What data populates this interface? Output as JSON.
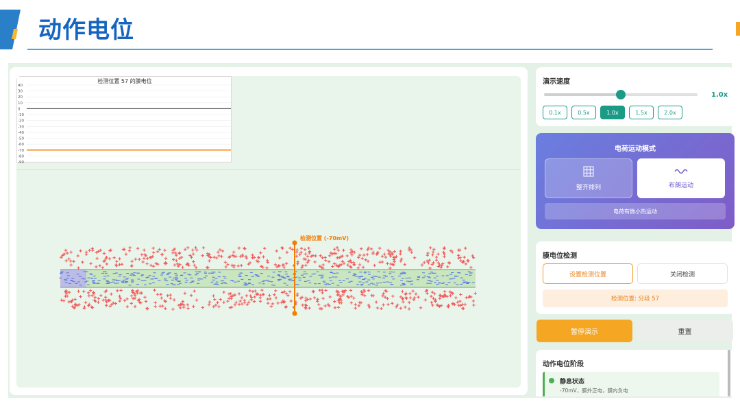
{
  "slide": {
    "title": "动作电位"
  },
  "chart": {
    "title": "检测位置 57 的膜电位",
    "y_ticks": [
      "40",
      "30",
      "20",
      "10",
      "0",
      "-10",
      "-20",
      "-30",
      "-40",
      "-50",
      "-60",
      "-70",
      "-80",
      "-90"
    ]
  },
  "chart_data": {
    "type": "line",
    "title": "检测位置 57 的膜电位",
    "xlabel": "",
    "ylabel": "",
    "ylim": [
      -90,
      40
    ],
    "series": [
      {
        "values": [
          -70,
          -70,
          -70,
          -70,
          -70,
          -70,
          -70,
          -70,
          -70,
          -70
        ],
        "color": "#f57c00"
      }
    ],
    "reference_lines": [
      {
        "y": 0,
        "color": "#555555"
      }
    ]
  },
  "simulation": {
    "probe_label": "检测位置 (-70mV)",
    "colors": {
      "positive": "#f05a5a",
      "negative": "#5b7be0",
      "membrane": "#c9e6bf",
      "probe": "#f57c00"
    }
  },
  "speed": {
    "title": "演示速度",
    "value": "1.0x",
    "level": 0.5,
    "options": [
      "0.1x",
      "0.5x",
      "1.0x",
      "1.5x",
      "2.0x"
    ],
    "selected": "1.0x"
  },
  "mode": {
    "title": "电荷运动模式",
    "ordered_label": "整齐排列",
    "ordered_icon": "grid-icon",
    "brownian_label": "布朗运动",
    "brownian_icon": "wave-icon",
    "note": "电荷有微小热运动"
  },
  "detect": {
    "title": "膜电位检测",
    "set_label": "设置检测位置",
    "close_label": "关闭检测",
    "status": "检测位置: 分段 57"
  },
  "actions": {
    "pause_label": "暂停演示",
    "reset_label": "重置"
  },
  "phase": {
    "title": "动作电位阶段",
    "items": [
      {
        "name": "静息状态",
        "desc": "-70mV，膜外正电，膜内负电",
        "color": "#4caf50"
      }
    ]
  },
  "theme": {
    "accent": "#1b9a86",
    "title_blue": "#1565c0",
    "orange": "#f5a623"
  }
}
